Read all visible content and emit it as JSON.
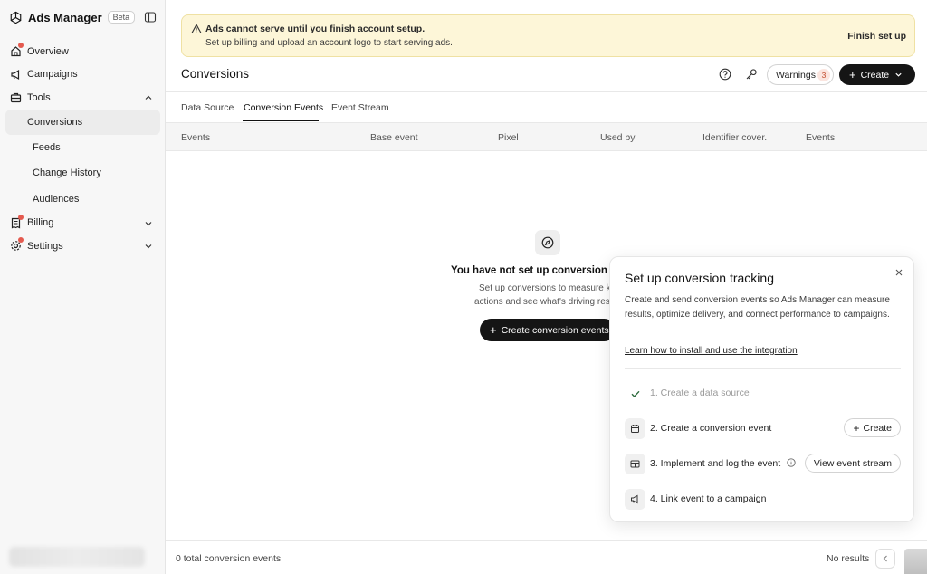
{
  "sidebar": {
    "app_name": "Ads Manager",
    "badge": "Beta",
    "nav": [
      {
        "label": "Overview",
        "icon": "home-icon",
        "notify": true
      },
      {
        "label": "Campaigns",
        "icon": "megaphone-icon",
        "notify": false
      },
      {
        "label": "Tools",
        "icon": "toolbox-icon",
        "notify": false,
        "expanded": true
      }
    ],
    "tools_sub": [
      "Conversions",
      "Feeds",
      "Change History",
      "Audiences"
    ],
    "nav_bottom": [
      {
        "label": "Billing",
        "icon": "receipt-icon",
        "notify": true,
        "expanded": false
      },
      {
        "label": "Settings",
        "icon": "gear-icon",
        "notify": true,
        "expanded": false
      }
    ],
    "active_item": "Conversions"
  },
  "banner": {
    "title": "Ads cannot serve until you finish account setup.",
    "text": "Set up billing and upload an account logo to start serving ads.",
    "action": "Finish set up"
  },
  "header": {
    "title": "Conversions",
    "warnings_label": "Warnings",
    "warnings_count": "3",
    "create_label": "Create"
  },
  "tabs": {
    "items": [
      "Data Source",
      "Conversion Events",
      "Event Stream"
    ],
    "active": "Conversion Events"
  },
  "table": {
    "columns": [
      "Events",
      "Base event",
      "Pixel",
      "Used by",
      "Identifier cover.",
      "Events"
    ]
  },
  "empty_state": {
    "title": "You have not set up conversion ev",
    "desc_line1": "Set up conversions to measure k",
    "desc_line2": "actions and see what's driving res",
    "button": "Create conversion events"
  },
  "popover": {
    "title": "Set up conversion tracking",
    "description": "Create and send conversion events so Ads Manager can measure results, optimize delivery, and connect performance to campaigns.",
    "link": "Learn how to install and use the integration",
    "steps": [
      {
        "label": "1. Create a data source",
        "status": "done",
        "icon": "check-icon"
      },
      {
        "label": "2. Create a conversion event",
        "status": "todo",
        "icon": "calendar-icon",
        "action": "Create"
      },
      {
        "label": "3. Implement and log the event",
        "status": "todo",
        "icon": "code-icon",
        "action": "View event stream"
      },
      {
        "label": "4. Link event to a campaign",
        "status": "todo",
        "icon": "megaphone-icon"
      }
    ]
  },
  "footer": {
    "count_text": "0 total conversion events",
    "results_text": "No results"
  },
  "colors": {
    "accent_dark": "#151515",
    "banner_bg": "#fdf6d8",
    "notify_dot": "#e45a4f",
    "warning_badge_text": "#c24a2a"
  }
}
